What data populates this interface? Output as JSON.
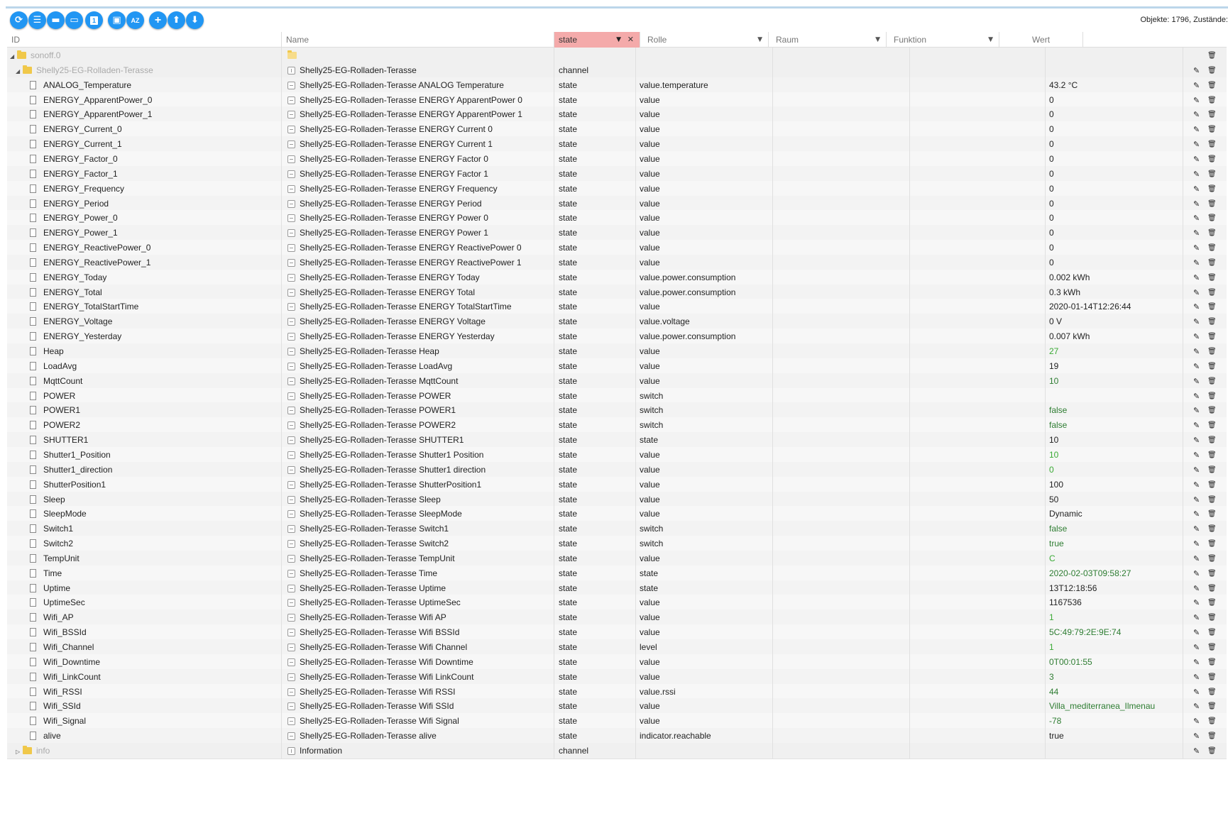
{
  "toolbar": {
    "buttons": [
      {
        "name": "refresh-button",
        "glyph": "⟳"
      },
      {
        "name": "list-view-button",
        "glyph": "☰"
      },
      {
        "name": "expand-folders-button",
        "glyph": "▬"
      },
      {
        "name": "collapse-folders-button",
        "glyph": "▭"
      },
      {
        "name": "filter-numbers-button",
        "glyph": "1"
      },
      {
        "name": "contacts-button",
        "glyph": "▣"
      },
      {
        "name": "sort-az-button",
        "glyph": "AZ"
      },
      {
        "name": "add-object-button",
        "glyph": "+"
      },
      {
        "name": "upload-button",
        "glyph": "⬆"
      },
      {
        "name": "download-button",
        "glyph": "⬇"
      }
    ],
    "object_count": "Objekte: 1796, Zustände:"
  },
  "columns": {
    "id": "ID",
    "name": "Name",
    "type": "state",
    "role": "Rolle",
    "room": "Raum",
    "function": "Funktion",
    "value": "Wert"
  },
  "rows": [
    {
      "level": 0,
      "kind": "folder",
      "expanded": true,
      "id": "sonoff.0",
      "name": "",
      "type": "",
      "role": "",
      "value": "",
      "dim": true
    },
    {
      "level": 1,
      "kind": "folder",
      "expanded": true,
      "id": "Shelly25-EG-Rolladen-Terasse",
      "name": "Shelly25-EG-Rolladen-Terasse",
      "type": "channel",
      "role": "",
      "value": "",
      "dim": true,
      "channel": true
    },
    {
      "level": 2,
      "kind": "state",
      "id": "ANALOG_Temperature",
      "name": "Shelly25-EG-Rolladen-Terasse ANALOG Temperature",
      "type": "state",
      "role": "value.temperature",
      "value": "43.2 °C"
    },
    {
      "level": 2,
      "kind": "state",
      "id": "ENERGY_ApparentPower_0",
      "name": "Shelly25-EG-Rolladen-Terasse ENERGY ApparentPower 0",
      "type": "state",
      "role": "value",
      "value": "0"
    },
    {
      "level": 2,
      "kind": "state",
      "id": "ENERGY_ApparentPower_1",
      "name": "Shelly25-EG-Rolladen-Terasse ENERGY ApparentPower 1",
      "type": "state",
      "role": "value",
      "value": "0"
    },
    {
      "level": 2,
      "kind": "state",
      "id": "ENERGY_Current_0",
      "name": "Shelly25-EG-Rolladen-Terasse ENERGY Current 0",
      "type": "state",
      "role": "value",
      "value": "0"
    },
    {
      "level": 2,
      "kind": "state",
      "id": "ENERGY_Current_1",
      "name": "Shelly25-EG-Rolladen-Terasse ENERGY Current 1",
      "type": "state",
      "role": "value",
      "value": "0"
    },
    {
      "level": 2,
      "kind": "state",
      "id": "ENERGY_Factor_0",
      "name": "Shelly25-EG-Rolladen-Terasse ENERGY Factor 0",
      "type": "state",
      "role": "value",
      "value": "0"
    },
    {
      "level": 2,
      "kind": "state",
      "id": "ENERGY_Factor_1",
      "name": "Shelly25-EG-Rolladen-Terasse ENERGY Factor 1",
      "type": "state",
      "role": "value",
      "value": "0"
    },
    {
      "level": 2,
      "kind": "state",
      "id": "ENERGY_Frequency",
      "name": "Shelly25-EG-Rolladen-Terasse ENERGY Frequency",
      "type": "state",
      "role": "value",
      "value": "0"
    },
    {
      "level": 2,
      "kind": "state",
      "id": "ENERGY_Period",
      "name": "Shelly25-EG-Rolladen-Terasse ENERGY Period",
      "type": "state",
      "role": "value",
      "value": "0"
    },
    {
      "level": 2,
      "kind": "state",
      "id": "ENERGY_Power_0",
      "name": "Shelly25-EG-Rolladen-Terasse ENERGY Power 0",
      "type": "state",
      "role": "value",
      "value": "0"
    },
    {
      "level": 2,
      "kind": "state",
      "id": "ENERGY_Power_1",
      "name": "Shelly25-EG-Rolladen-Terasse ENERGY Power 1",
      "type": "state",
      "role": "value",
      "value": "0"
    },
    {
      "level": 2,
      "kind": "state",
      "id": "ENERGY_ReactivePower_0",
      "name": "Shelly25-EG-Rolladen-Terasse ENERGY ReactivePower 0",
      "type": "state",
      "role": "value",
      "value": "0"
    },
    {
      "level": 2,
      "kind": "state",
      "id": "ENERGY_ReactivePower_1",
      "name": "Shelly25-EG-Rolladen-Terasse ENERGY ReactivePower 1",
      "type": "state",
      "role": "value",
      "value": "0"
    },
    {
      "level": 2,
      "kind": "state",
      "id": "ENERGY_Today",
      "name": "Shelly25-EG-Rolladen-Terasse ENERGY Today",
      "type": "state",
      "role": "value.power.consumption",
      "value": "0.002 kWh"
    },
    {
      "level": 2,
      "kind": "state",
      "id": "ENERGY_Total",
      "name": "Shelly25-EG-Rolladen-Terasse ENERGY Total",
      "type": "state",
      "role": "value.power.consumption",
      "value": "0.3 kWh"
    },
    {
      "level": 2,
      "kind": "state",
      "id": "ENERGY_TotalStartTime",
      "name": "Shelly25-EG-Rolladen-Terasse ENERGY TotalStartTime",
      "type": "state",
      "role": "value",
      "value": "2020-01-14T12:26:44"
    },
    {
      "level": 2,
      "kind": "state",
      "id": "ENERGY_Voltage",
      "name": "Shelly25-EG-Rolladen-Terasse ENERGY Voltage",
      "type": "state",
      "role": "value.voltage",
      "value": "0 V"
    },
    {
      "level": 2,
      "kind": "state",
      "id": "ENERGY_Yesterday",
      "name": "Shelly25-EG-Rolladen-Terasse ENERGY Yesterday",
      "type": "state",
      "role": "value.power.consumption",
      "value": "0.007 kWh"
    },
    {
      "level": 2,
      "kind": "state",
      "id": "Heap",
      "name": "Shelly25-EG-Rolladen-Terasse Heap",
      "type": "state",
      "role": "value",
      "value": "27",
      "color": "green"
    },
    {
      "level": 2,
      "kind": "state",
      "id": "LoadAvg",
      "name": "Shelly25-EG-Rolladen-Terasse LoadAvg",
      "type": "state",
      "role": "value",
      "value": "19",
      "clipped": true
    },
    {
      "level": 2,
      "kind": "state",
      "id": "MqttCount",
      "name": "Shelly25-EG-Rolladen-Terasse MqttCount",
      "type": "state",
      "role": "value",
      "value": "10",
      "color": "dark"
    },
    {
      "level": 2,
      "kind": "state",
      "id": "POWER",
      "name": "Shelly25-EG-Rolladen-Terasse POWER",
      "type": "state",
      "role": "switch",
      "value": ""
    },
    {
      "level": 2,
      "kind": "state",
      "id": "POWER1",
      "name": "Shelly25-EG-Rolladen-Terasse POWER1",
      "type": "state",
      "role": "switch",
      "value": "false",
      "color": "dark"
    },
    {
      "level": 2,
      "kind": "state",
      "id": "POWER2",
      "name": "Shelly25-EG-Rolladen-Terasse POWER2",
      "type": "state",
      "role": "switch",
      "value": "false",
      "color": "dark"
    },
    {
      "level": 2,
      "kind": "state",
      "id": "SHUTTER1",
      "name": "Shelly25-EG-Rolladen-Terasse SHUTTER1",
      "type": "state",
      "role": "state",
      "value": "10"
    },
    {
      "level": 2,
      "kind": "state",
      "id": "Shutter1_Position",
      "name": "Shelly25-EG-Rolladen-Terasse Shutter1 Position",
      "type": "state",
      "role": "value",
      "value": "10",
      "color": "green"
    },
    {
      "level": 2,
      "kind": "state",
      "id": "Shutter1_direction",
      "name": "Shelly25-EG-Rolladen-Terasse Shutter1 direction",
      "type": "state",
      "role": "value",
      "value": "0",
      "color": "green"
    },
    {
      "level": 2,
      "kind": "state",
      "id": "ShutterPosition1",
      "name": "Shelly25-EG-Rolladen-Terasse ShutterPosition1",
      "type": "state",
      "role": "value",
      "value": "100"
    },
    {
      "level": 2,
      "kind": "state",
      "id": "Sleep",
      "name": "Shelly25-EG-Rolladen-Terasse Sleep",
      "type": "state",
      "role": "value",
      "value": "50"
    },
    {
      "level": 2,
      "kind": "state",
      "id": "SleepMode",
      "name": "Shelly25-EG-Rolladen-Terasse SleepMode",
      "type": "state",
      "role": "value",
      "value": "Dynamic"
    },
    {
      "level": 2,
      "kind": "state",
      "id": "Switch1",
      "name": "Shelly25-EG-Rolladen-Terasse Switch1",
      "type": "state",
      "role": "switch",
      "value": "false",
      "color": "dark"
    },
    {
      "level": 2,
      "kind": "state",
      "id": "Switch2",
      "name": "Shelly25-EG-Rolladen-Terasse Switch2",
      "type": "state",
      "role": "switch",
      "value": "true",
      "color": "dark"
    },
    {
      "level": 2,
      "kind": "state",
      "id": "TempUnit",
      "name": "Shelly25-EG-Rolladen-Terasse TempUnit",
      "type": "state",
      "role": "value",
      "value": "C",
      "color": "green"
    },
    {
      "level": 2,
      "kind": "state",
      "id": "Time",
      "name": "Shelly25-EG-Rolladen-Terasse Time",
      "type": "state",
      "role": "state",
      "value": "2020-02-03T09:58:27",
      "color": "dark"
    },
    {
      "level": 2,
      "kind": "state",
      "id": "Uptime",
      "name": "Shelly25-EG-Rolladen-Terasse Uptime",
      "type": "state",
      "role": "state",
      "value": "13T12:18:56"
    },
    {
      "level": 2,
      "kind": "state",
      "id": "UptimeSec",
      "name": "Shelly25-EG-Rolladen-Terasse UptimeSec",
      "type": "state",
      "role": "value",
      "value": "1167536"
    },
    {
      "level": 2,
      "kind": "state",
      "id": "Wifi_AP",
      "name": "Shelly25-EG-Rolladen-Terasse Wifi AP",
      "type": "state",
      "role": "value",
      "value": "1",
      "color": "green"
    },
    {
      "level": 2,
      "kind": "state",
      "id": "Wifi_BSSId",
      "name": "Shelly25-EG-Rolladen-Terasse Wifi BSSId",
      "type": "state",
      "role": "value",
      "value": "5C:49:79:2E:9E:74",
      "color": "dark"
    },
    {
      "level": 2,
      "kind": "state",
      "id": "Wifi_Channel",
      "name": "Shelly25-EG-Rolladen-Terasse Wifi Channel",
      "type": "state",
      "role": "level",
      "value": "1",
      "color": "green"
    },
    {
      "level": 2,
      "kind": "state",
      "id": "Wifi_Downtime",
      "name": "Shelly25-EG-Rolladen-Terasse Wifi Downtime",
      "type": "state",
      "role": "value",
      "value": "0T00:01:55",
      "color": "dark"
    },
    {
      "level": 2,
      "kind": "state",
      "id": "Wifi_LinkCount",
      "name": "Shelly25-EG-Rolladen-Terasse Wifi LinkCount",
      "type": "state",
      "role": "value",
      "value": "3",
      "color": "dark"
    },
    {
      "level": 2,
      "kind": "state",
      "id": "Wifi_RSSI",
      "name": "Shelly25-EG-Rolladen-Terasse Wifi RSSI",
      "type": "state",
      "role": "value.rssi",
      "value": "44",
      "color": "dark"
    },
    {
      "level": 2,
      "kind": "state",
      "id": "Wifi_SSId",
      "name": "Shelly25-EG-Rolladen-Terasse Wifi SSId",
      "type": "state",
      "role": "value",
      "value": "Villa_mediterranea_Ilmenau",
      "color": "dark"
    },
    {
      "level": 2,
      "kind": "state",
      "id": "Wifi_Signal",
      "name": "Shelly25-EG-Rolladen-Terasse Wifi Signal",
      "type": "state",
      "role": "value",
      "value": "-78",
      "color": "dark"
    },
    {
      "level": 2,
      "kind": "state",
      "id": "alive",
      "name": "Shelly25-EG-Rolladen-Terasse alive",
      "type": "state",
      "role": "indicator.reachable",
      "value": "true"
    },
    {
      "level": 1,
      "kind": "folder",
      "expanded": false,
      "id": "info",
      "name": "Information",
      "type": "channel",
      "role": "",
      "value": "",
      "dim": true,
      "channel": true
    }
  ]
}
